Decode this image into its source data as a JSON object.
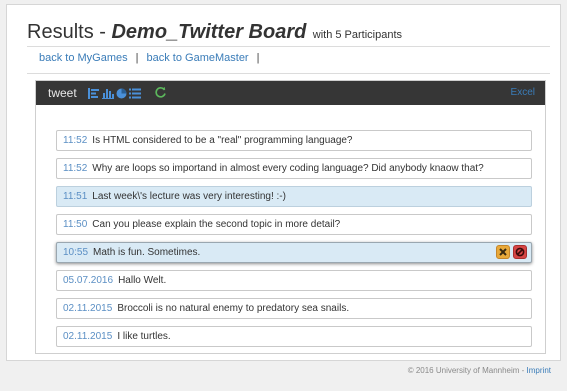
{
  "header": {
    "title_prefix": "Results - ",
    "board_name": "Demo_Twitter Board",
    "subtitle": "with 5 Participants"
  },
  "nav": {
    "back_mygames": "back to MyGames",
    "separator": "|",
    "back_gamemaster": "back to GameMaster"
  },
  "panel": {
    "title": "tweet",
    "excel_label": "Excel",
    "icons": [
      "bar-chart-horizontal-icon",
      "bar-chart-icon",
      "pie-chart-icon",
      "list-icon",
      "refresh-icon"
    ]
  },
  "tweets": [
    {
      "time": "11:52",
      "text": "Is HTML considered to be a \"real\" programming language?"
    },
    {
      "time": "11:52",
      "text": "Why are loops so importand in almost every coding language? Did anybody knaow that?"
    },
    {
      "time": "11:51",
      "text": "Last week\\'s lecture was very interesting! :-)"
    },
    {
      "time": "11:50",
      "text": "Can you please explain the second topic in more detail?"
    },
    {
      "time": "10:55",
      "text": "Math is fun. Sometimes."
    },
    {
      "time": "05.07.2016",
      "text": "Hallo Welt."
    },
    {
      "time": "02.11.2015",
      "text": "Broccoli is no natural enemy to predatory sea snails."
    },
    {
      "time": "02.11.2015",
      "text": "I like turtles."
    }
  ],
  "footer": {
    "copyright": "© 2016 University of Mannheim - ",
    "imprint": "Imprint"
  },
  "colors": {
    "accent": "#3a7cb8",
    "highlight": "#d9eaf5",
    "header_bar": "#363636",
    "remove_button": "#e8a93a",
    "block_button": "#d64545"
  }
}
